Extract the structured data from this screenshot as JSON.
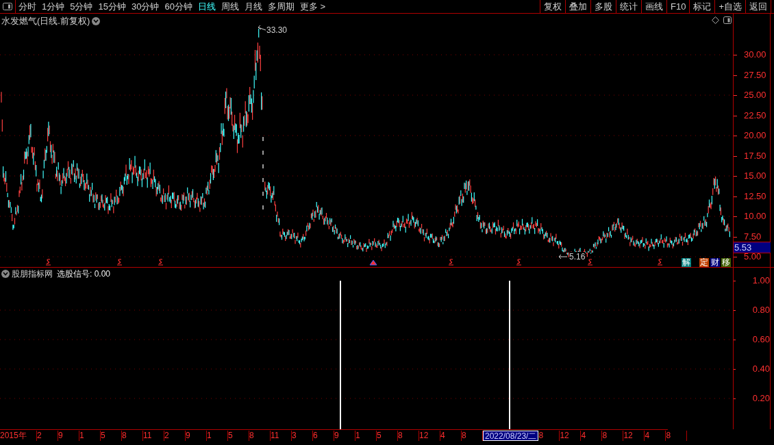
{
  "toolbar": {
    "periods": [
      {
        "label": "分时",
        "selected": false
      },
      {
        "label": "1分钟",
        "selected": false
      },
      {
        "label": "5分钟",
        "selected": false
      },
      {
        "label": "15分钟",
        "selected": false
      },
      {
        "label": "30分钟",
        "selected": false
      },
      {
        "label": "60分钟",
        "selected": false
      },
      {
        "label": "日线",
        "selected": true
      },
      {
        "label": "周线",
        "selected": false
      },
      {
        "label": "月线",
        "selected": false
      },
      {
        "label": "多周期",
        "selected": false
      },
      {
        "label": "更多 >",
        "selected": false
      }
    ],
    "buttons": [
      "复权",
      "叠加",
      "多股",
      "统计",
      "画线",
      "F10",
      "标记",
      "+自选",
      "返回"
    ]
  },
  "price_pane": {
    "title": "水发燃气(日线.前复权)",
    "high_label": "33.30",
    "low_label": "5.16",
    "y_axis": [
      "30.00",
      "27.50",
      "25.00",
      "22.50",
      "20.00",
      "17.50",
      "15.00",
      "12.50",
      "10.00",
      "7.50",
      "5.00"
    ],
    "last_price": "5.53",
    "badges": [
      {
        "label": "解",
        "color": "#008080"
      },
      {
        "label": "定",
        "color": "#c04000"
      },
      {
        "label": "财",
        "color": "#000080"
      },
      {
        "label": "移",
        "color": "#406000"
      }
    ]
  },
  "indicator_pane": {
    "title": "股朋指标网",
    "signal_label": "选股信号: 0.00",
    "y_axis": [
      "1.00",
      "0.80",
      "0.60",
      "0.40",
      "0.20"
    ]
  },
  "date_axis": [
    {
      "label": "2015年",
      "selected": false
    },
    {
      "label": "2",
      "selected": false
    },
    {
      "label": "9",
      "selected": false
    },
    {
      "label": "1",
      "selected": false
    },
    {
      "label": "5",
      "selected": false
    },
    {
      "label": "8",
      "selected": false
    },
    {
      "label": "11",
      "selected": false
    },
    {
      "label": "2",
      "selected": false
    },
    {
      "label": "9",
      "selected": false
    },
    {
      "label": "1",
      "selected": false
    },
    {
      "label": "5",
      "selected": false
    },
    {
      "label": "8",
      "selected": false
    },
    {
      "label": "11",
      "selected": false
    },
    {
      "label": "3",
      "selected": false
    },
    {
      "label": "6",
      "selected": false
    },
    {
      "label": "9",
      "selected": false
    },
    {
      "label": "1",
      "selected": false
    },
    {
      "label": "5",
      "selected": false
    },
    {
      "label": "8",
      "selected": false
    },
    {
      "label": "12",
      "selected": false
    },
    {
      "label": "4",
      "selected": false
    },
    {
      "label": "8",
      "selected": false
    },
    {
      "label": "2022/08/23/二",
      "selected": true
    },
    {
      "label": "8",
      "selected": false
    },
    {
      "label": "12",
      "selected": false
    },
    {
      "label": "4",
      "selected": false
    },
    {
      "label": "8",
      "selected": false
    },
    {
      "label": "12",
      "selected": false
    },
    {
      "label": "4",
      "selected": false
    },
    {
      "label": "8",
      "selected": false
    }
  ]
}
